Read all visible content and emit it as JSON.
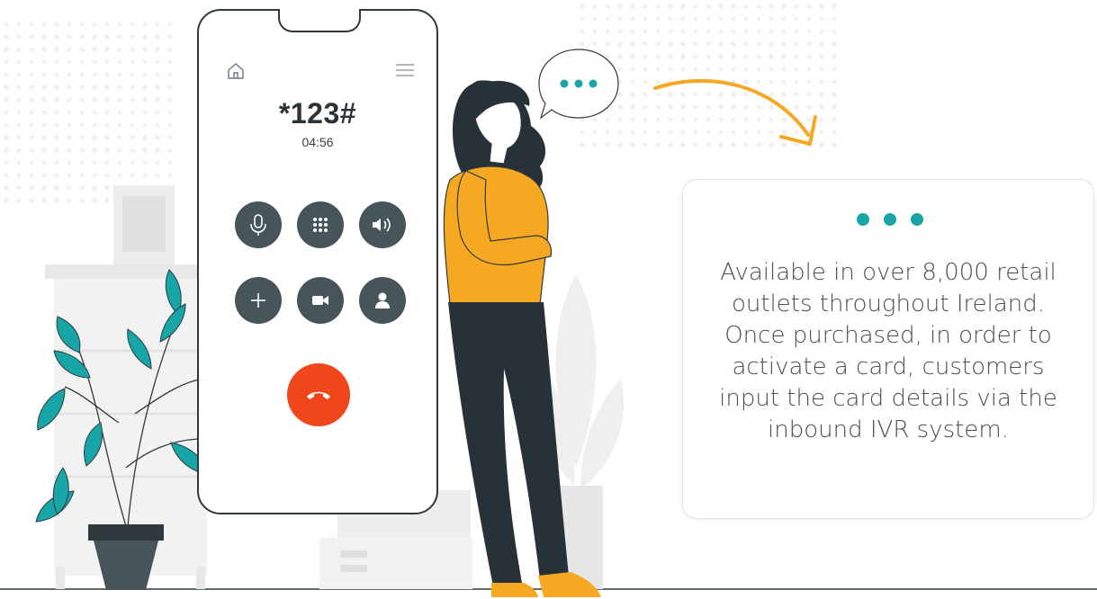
{
  "phone": {
    "dial_code": "*123#",
    "call_time": "04:56",
    "icons": [
      "home-icon",
      "menu-icon",
      "microphone-icon",
      "keypad-icon",
      "speaker-icon",
      "add-call-icon",
      "video-icon",
      "contact-icon",
      "hang-up-icon"
    ]
  },
  "card": {
    "text": "Available in over 8,000 retail outlets throughout Ireland. Once purchased, in order to activate a card, customers input the card details via the inbound IVR system."
  },
  "colors": {
    "teal": "#17a5a8",
    "accent_yellow": "#f7a823",
    "end_call_red": "#f0461c",
    "button_dark": "#455559",
    "outline": "#2f3a3e"
  }
}
